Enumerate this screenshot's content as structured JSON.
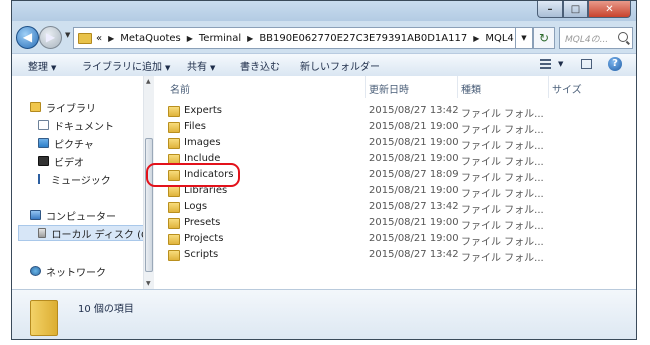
{
  "address": {
    "crumbs": [
      "«",
      "MetaQuotes",
      "Terminal",
      "BB190E062770E27C3E79391AB0D1A117",
      "MQL4"
    ],
    "search_placeholder": "MQL4の..."
  },
  "toolbar": {
    "organize": "整理",
    "include_in_library": "ライブラリに追加",
    "share": "共有",
    "burn": "書き込む",
    "new_folder": "新しいフォルダー"
  },
  "nav": {
    "libraries": "ライブラリ",
    "documents": "ドキュメント",
    "pictures": "ピクチャ",
    "videos": "ビデオ",
    "music": "ミュージック",
    "computer": "コンピューター",
    "local_disk": "ローカル ディスク (C",
    "network": "ネットワーク"
  },
  "columns": {
    "name": "名前",
    "date": "更新日時",
    "type": "種類",
    "size": "サイズ"
  },
  "files": [
    {
      "name": "Experts",
      "date": "2015/08/27 13:42",
      "type": "ファイル フォル..."
    },
    {
      "name": "Files",
      "date": "2015/08/21 19:00",
      "type": "ファイル フォル..."
    },
    {
      "name": "Images",
      "date": "2015/08/21 19:00",
      "type": "ファイル フォル..."
    },
    {
      "name": "Include",
      "date": "2015/08/21 19:00",
      "type": "ファイル フォル..."
    },
    {
      "name": "Indicators",
      "date": "2015/08/27 18:09",
      "type": "ファイル フォル..."
    },
    {
      "name": "Libraries",
      "date": "2015/08/21 19:00",
      "type": "ファイル フォル..."
    },
    {
      "name": "Logs",
      "date": "2015/08/27 13:42",
      "type": "ファイル フォル..."
    },
    {
      "name": "Presets",
      "date": "2015/08/21 19:00",
      "type": "ファイル フォル..."
    },
    {
      "name": "Projects",
      "date": "2015/08/21 19:00",
      "type": "ファイル フォル..."
    },
    {
      "name": "Scripts",
      "date": "2015/08/27 13:42",
      "type": "ファイル フォル..."
    }
  ],
  "status": {
    "item_count": "10 個の項目"
  },
  "colors": {
    "highlight_ring": "#e3121b"
  }
}
